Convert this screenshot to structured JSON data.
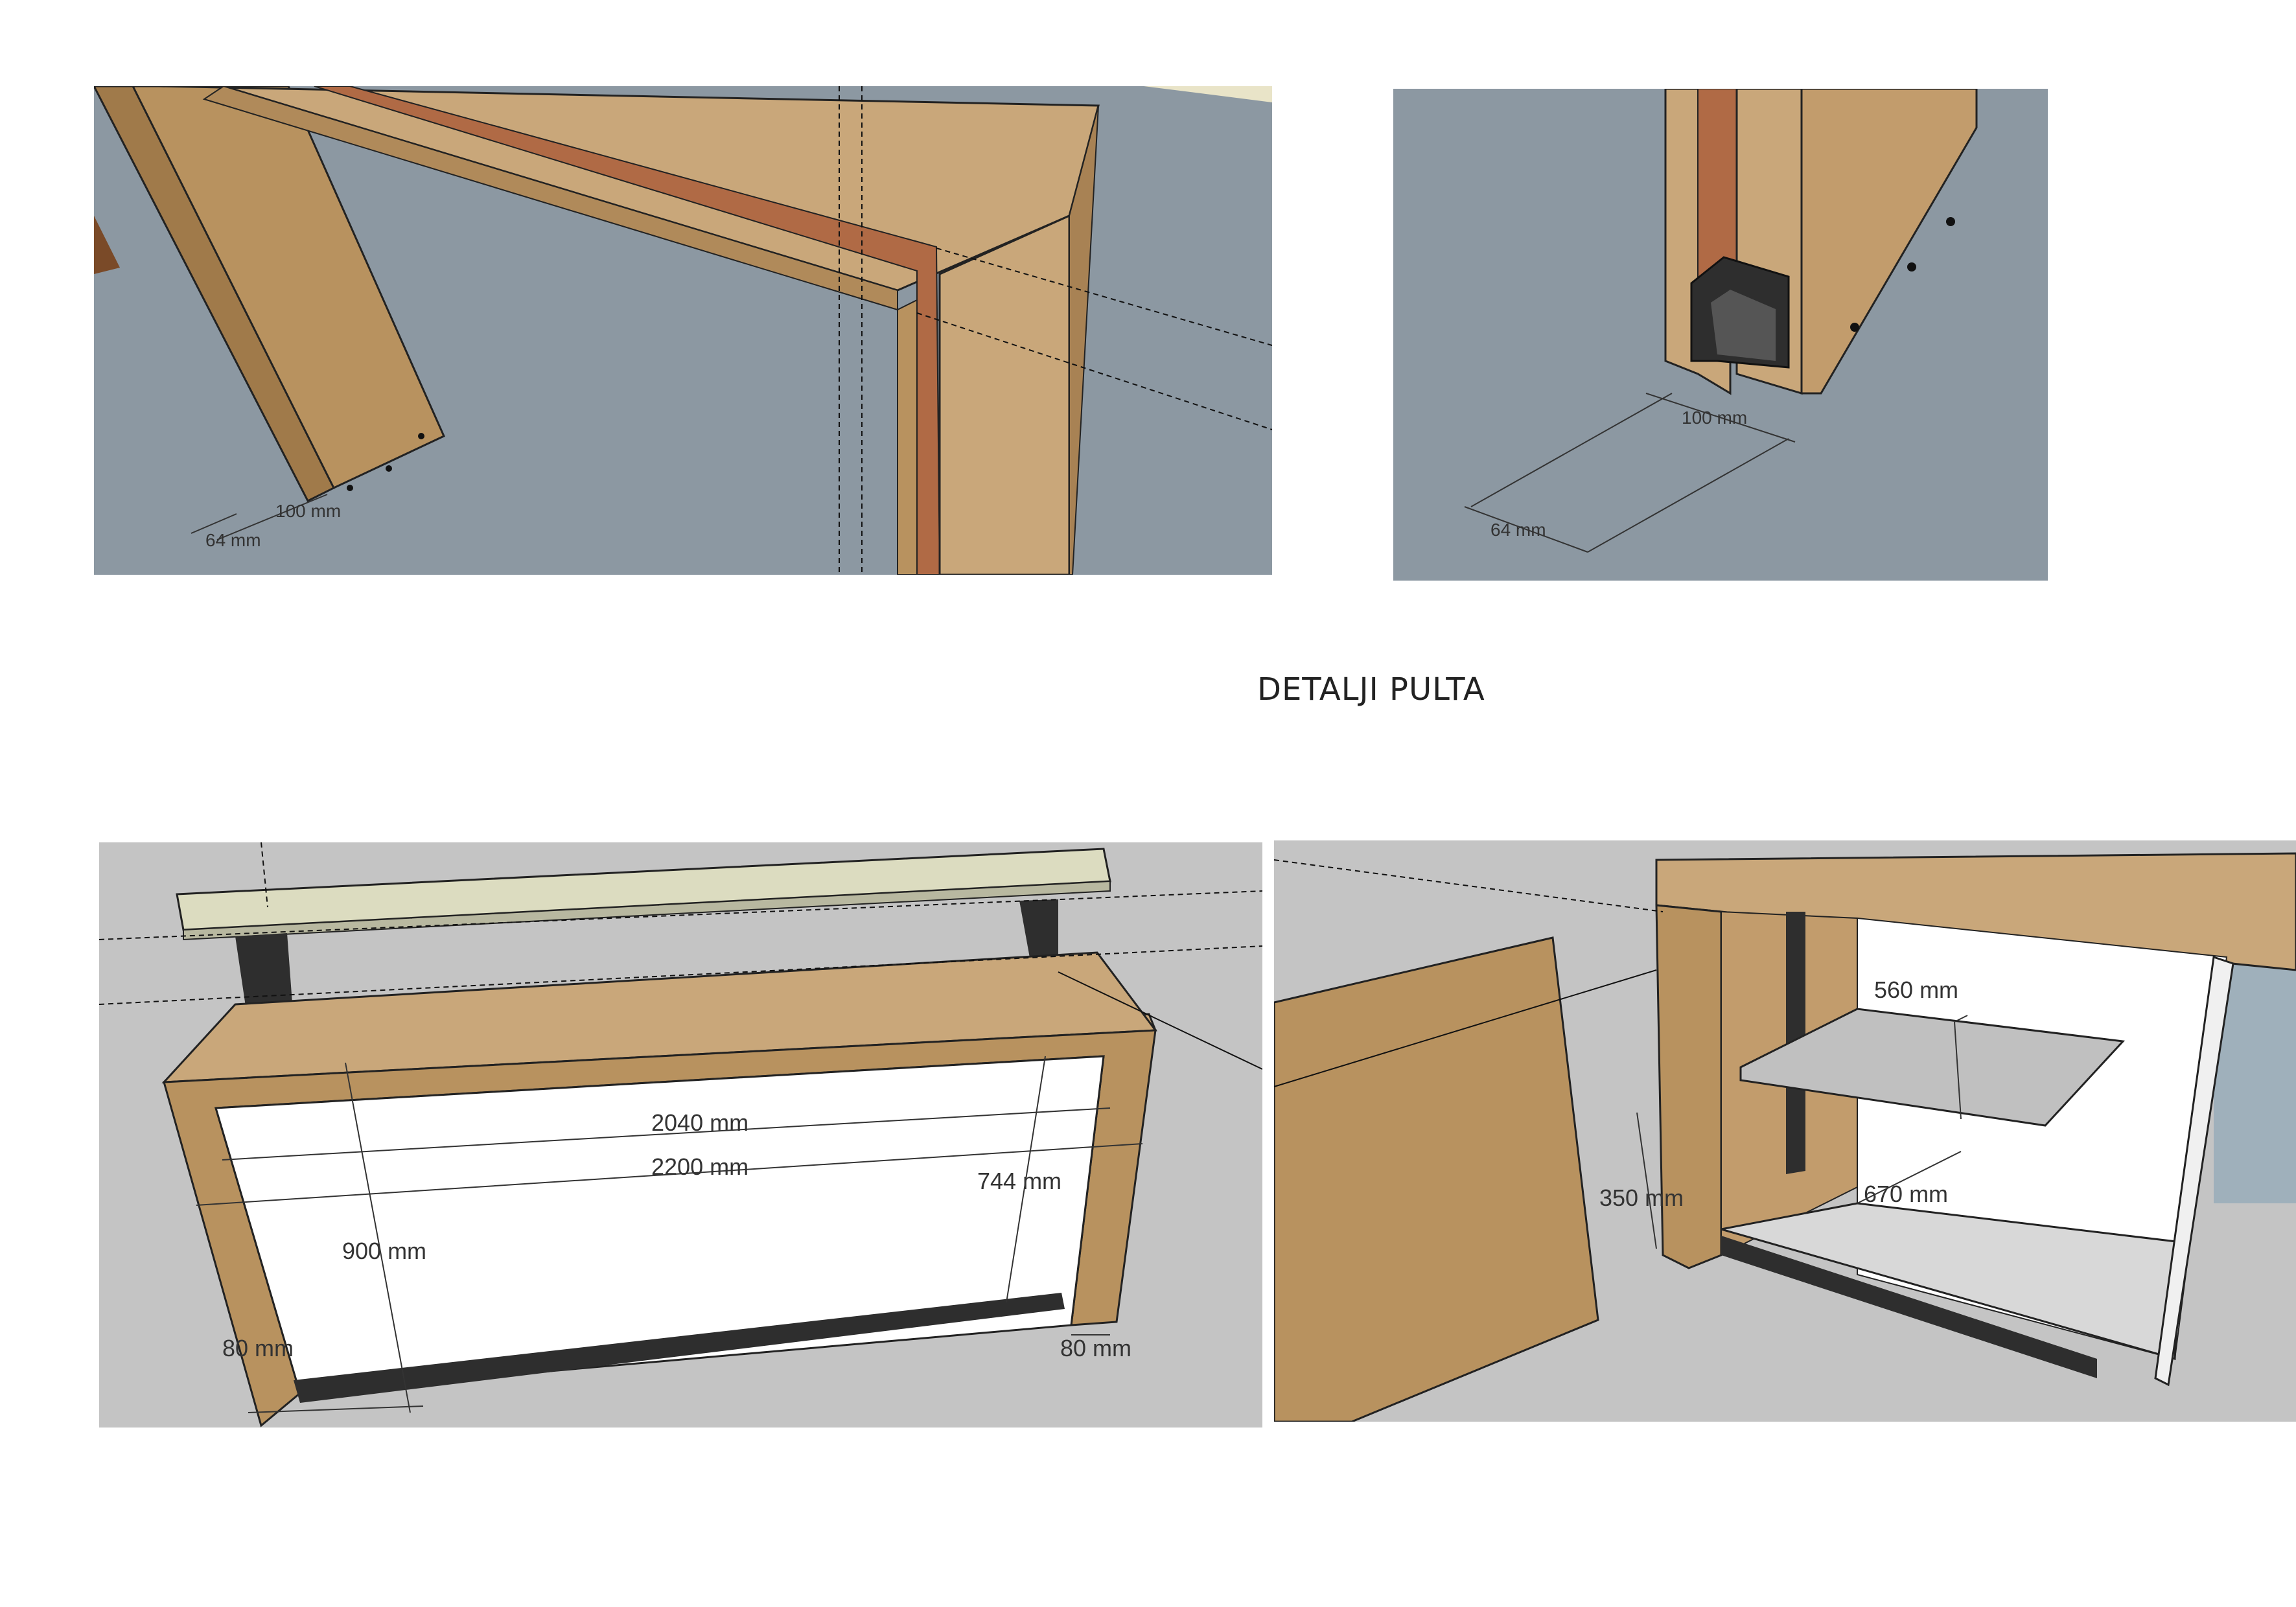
{
  "page": {
    "title": "DETALJI PULTA"
  },
  "colors": {
    "background_blue_gray": "#8c98a2",
    "background_light_gray": "#c4c4c4",
    "wood_light": "#c9a77a",
    "wood_mid": "#b08a5a",
    "wood_dark": "#8a6a44",
    "copper_strip": "#b06a45",
    "steel": "#2e2e2e",
    "panel_white": "#ffffff",
    "top_cream": "#dcdcc0"
  },
  "panels": {
    "top_left": {
      "dims": {
        "a": "100 mm",
        "b": "64 mm"
      }
    },
    "top_right": {
      "dims": {
        "a": "100 mm",
        "b": "64 mm"
      }
    },
    "bottom_left": {
      "dims": {
        "inner_width": "2040 mm",
        "outer_width": "2200 mm",
        "height": "900 mm",
        "depth": "744 mm",
        "left_leg": "80 mm",
        "right_leg": "80 mm"
      }
    },
    "bottom_right": {
      "dims": {
        "shelf_depth": "560 mm",
        "shelf_height": "350 mm",
        "shelf_width": "670 mm"
      }
    }
  }
}
